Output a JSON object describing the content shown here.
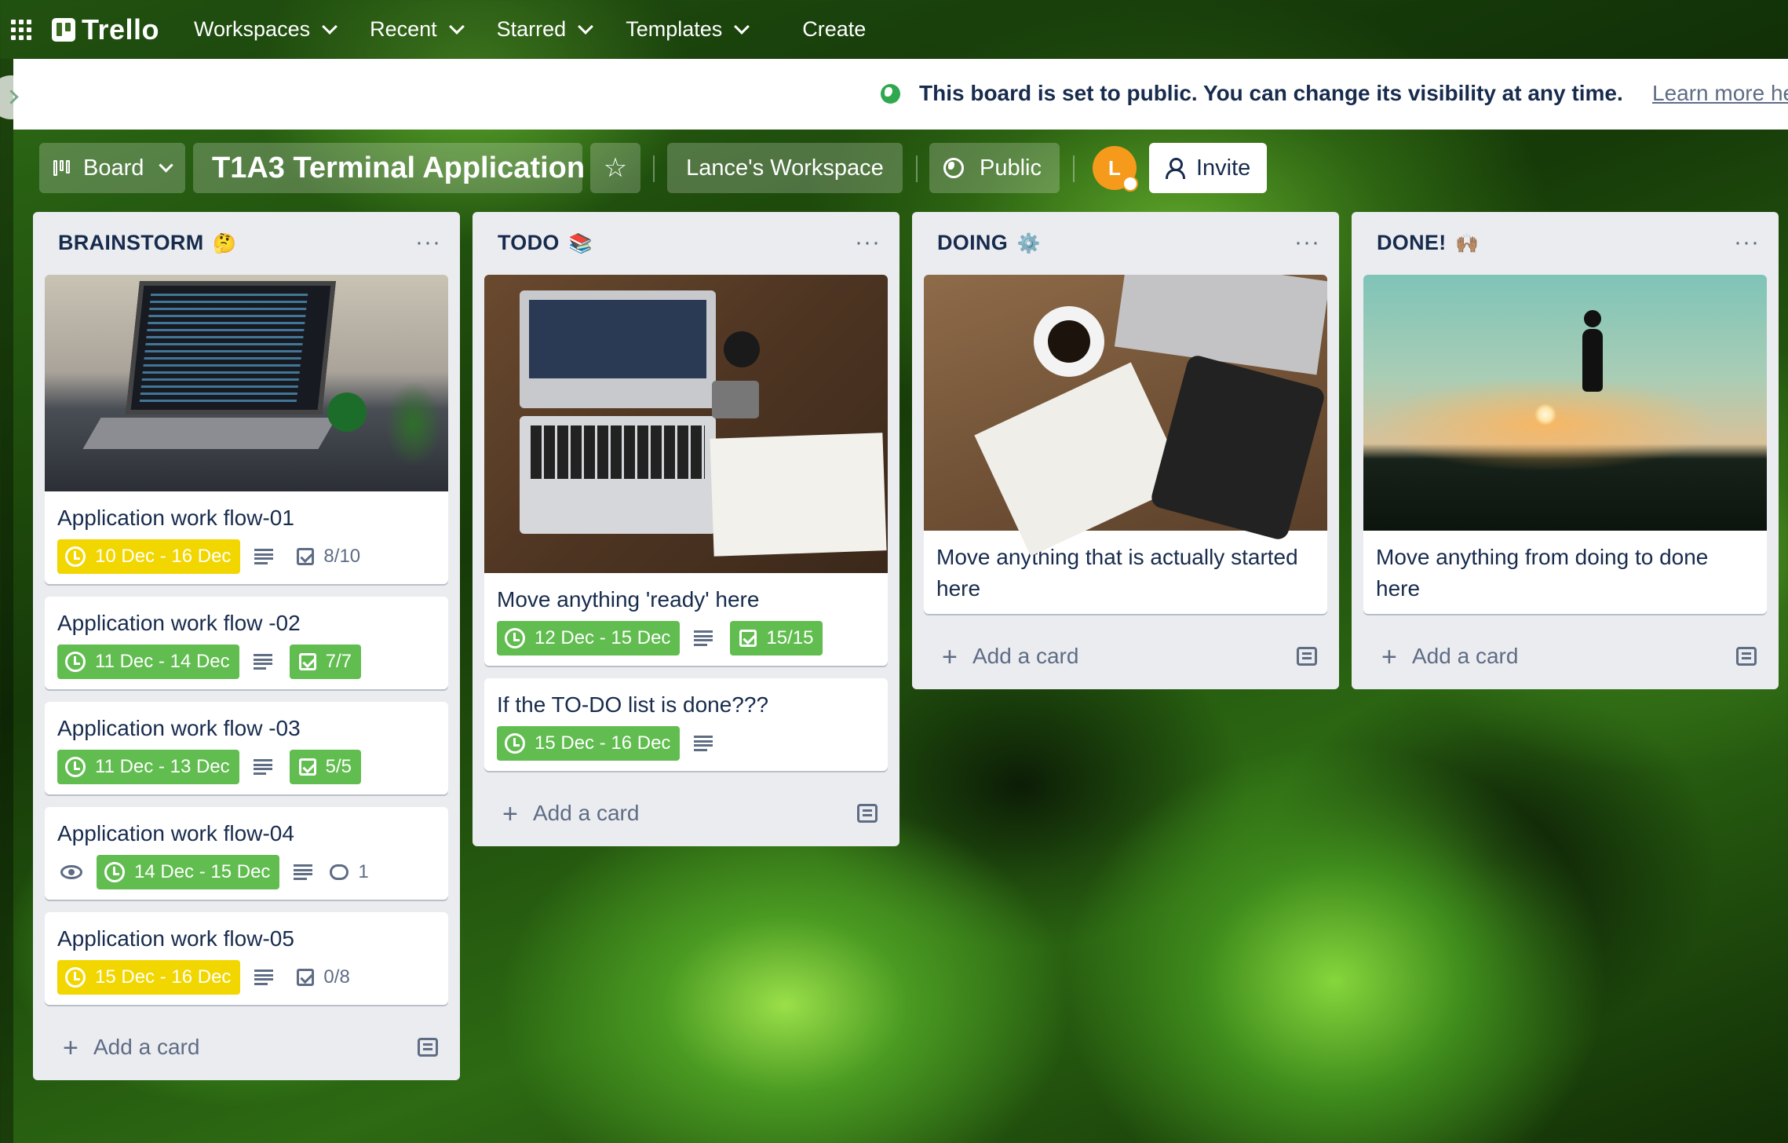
{
  "topbar": {
    "logo": "Trello",
    "nav": [
      "Workspaces",
      "Recent",
      "Starred",
      "Templates"
    ],
    "create": "Create"
  },
  "banner": {
    "message": "This board is set to public. You can change its visibility at any time.",
    "link": "Learn more here"
  },
  "board": {
    "view": "Board",
    "title": "T1A3 Terminal Application",
    "workspace": "Lance's Workspace",
    "visibility": "Public",
    "avatar_initial": "L",
    "invite": "Invite"
  },
  "lists": [
    {
      "title": "BRAINSTORM",
      "emoji": "🤔",
      "cards": [
        {
          "title": "Application work flow-01",
          "due": "10 Dec - 16 Dec",
          "due_color": "yellow",
          "checklist": "8/10",
          "checklist_complete": false
        },
        {
          "title": "Application work flow -02",
          "due": "11 Dec - 14 Dec",
          "due_color": "green",
          "checklist": "7/7",
          "checklist_complete": true
        },
        {
          "title": "Application work flow -03",
          "due": "11 Dec - 13 Dec",
          "due_color": "green",
          "checklist": "5/5",
          "checklist_complete": true
        },
        {
          "title": "Application work flow-04",
          "due": "14 Dec - 15 Dec",
          "due_color": "green",
          "comments": "1"
        },
        {
          "title": "Application work flow-05",
          "due": "15 Dec - 16 Dec",
          "due_color": "yellow",
          "checklist": "0/8",
          "checklist_complete": false
        }
      ],
      "add_card": "Add a card"
    },
    {
      "title": "TODO",
      "emoji": "📚",
      "cards": [
        {
          "title": "Move anything 'ready' here",
          "due": "12 Dec - 15 Dec",
          "due_color": "green",
          "checklist": "15/15",
          "checklist_complete": true
        },
        {
          "title": "If the TO-DO list is done???",
          "due": "15 Dec - 16 Dec",
          "due_color": "green"
        }
      ],
      "add_card": "Add a card"
    },
    {
      "title": "DOING",
      "emoji": "⚙️",
      "cards": [
        {
          "title": "Move anything that is actually started here"
        }
      ],
      "add_card": "Add a card"
    },
    {
      "title": "DONE!",
      "emoji": "🙌🏽",
      "cards": [
        {
          "title": "Move anything from doing to done here"
        }
      ],
      "add_card": "Add a card"
    }
  ],
  "colors": {
    "due_yellow": "#f2d600",
    "due_green": "#61bd4f",
    "list_bg": "#ebecf0",
    "text": "#172b4d",
    "avatar": "#f59a1b"
  }
}
